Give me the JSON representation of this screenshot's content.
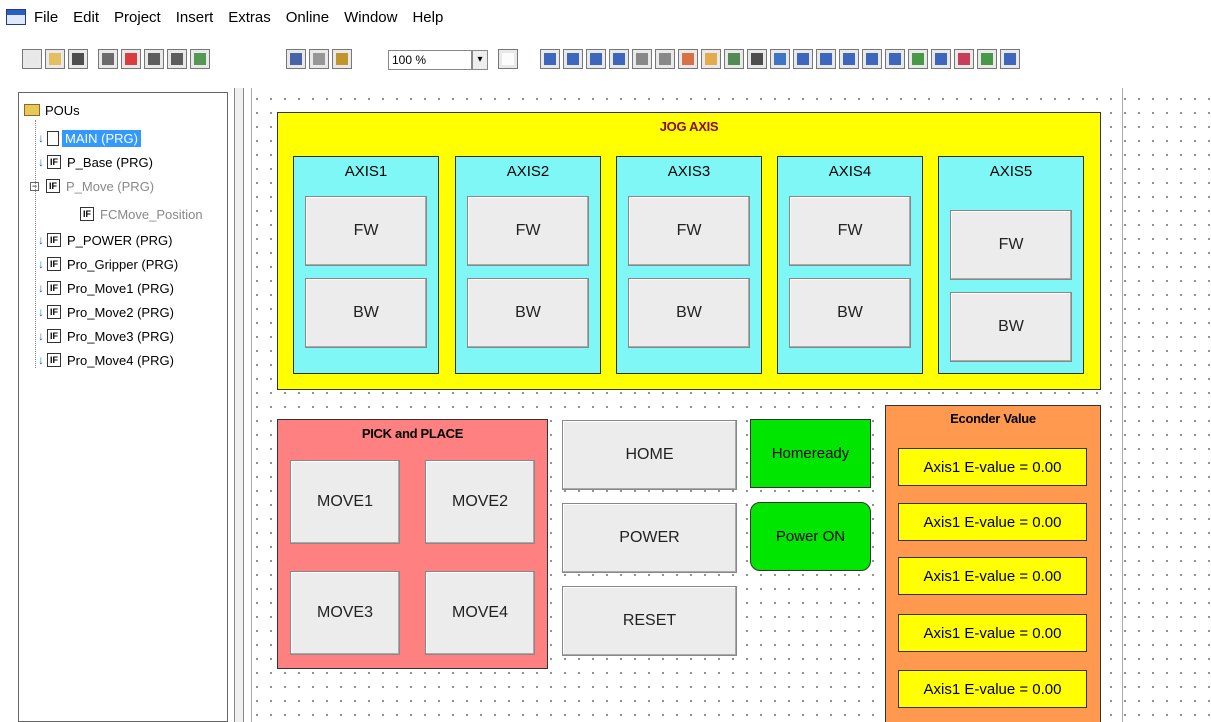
{
  "menu": [
    "File",
    "Edit",
    "Project",
    "Insert",
    "Extras",
    "Online",
    "Window",
    "Help"
  ],
  "toolbar": {
    "zoom": "100 %",
    "zoom_arrow": "▾"
  },
  "tree": {
    "root": "POUs",
    "items": [
      {
        "label": "MAIN (PRG)",
        "selected": true
      },
      {
        "label": "P_Base (PRG)"
      },
      {
        "label": "P_Move (PRG)"
      },
      {
        "label": "FCMove_Position"
      },
      {
        "label": "P_POWER (PRG)"
      },
      {
        "label": "Pro_Gripper (PRG)"
      },
      {
        "label": "Pro_Move1 (PRG)"
      },
      {
        "label": "Pro_Move2 (PRG)"
      },
      {
        "label": "Pro_Move3 (PRG)"
      },
      {
        "label": "Pro_Move4 (PRG)"
      }
    ]
  },
  "jog": {
    "title": "JOG AXIS",
    "axes": [
      {
        "name": "AXIS1",
        "fw": "FW",
        "bw": "BW"
      },
      {
        "name": "AXIS2",
        "fw": "FW",
        "bw": "BW"
      },
      {
        "name": "AXIS3",
        "fw": "FW",
        "bw": "BW"
      },
      {
        "name": "AXIS4",
        "fw": "FW",
        "bw": "BW"
      },
      {
        "name": "AXIS5",
        "fw": "FW",
        "bw": "BW"
      }
    ]
  },
  "pick": {
    "title": "PICK and PLACE",
    "moves": [
      "MOVE1",
      "MOVE2",
      "MOVE3",
      "MOVE4"
    ]
  },
  "controls": {
    "home": "HOME",
    "power": "POWER",
    "reset": "RESET"
  },
  "status": {
    "homeready": "Homeready",
    "power_on": "Power ON"
  },
  "encoder": {
    "title": "Econder Value",
    "values": [
      "Axis1 E-value = 0.00",
      "Axis1 E-value = 0.00",
      "Axis1 E-value = 0.00",
      "Axis1 E-value = 0.00",
      "Axis1 E-value = 0.00"
    ]
  },
  "colors": {
    "jog_bg": "#ffff00",
    "axis_bg": "#7ff7f7",
    "pick_bg": "#ff8080",
    "status_green": "#00e600",
    "encoder_bg": "#ff9950",
    "selection": "#3399ff",
    "section_title": "#8b0a28"
  }
}
